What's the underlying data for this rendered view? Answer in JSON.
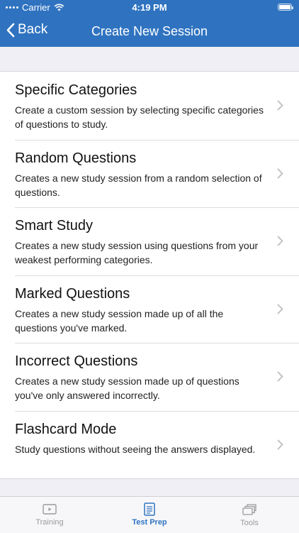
{
  "status_bar": {
    "carrier": "Carrier",
    "time": "4:19 PM"
  },
  "nav": {
    "back_label": "Back",
    "title": "Create New Session"
  },
  "options": [
    {
      "title": "Specific Categories",
      "description": "Create a custom session by selecting specific categories of questions to study."
    },
    {
      "title": "Random Questions",
      "description": "Creates a new study session from a random selection of questions."
    },
    {
      "title": "Smart Study",
      "description": "Creates a new study session using questions from your weakest performing categories."
    },
    {
      "title": "Marked Questions",
      "description": "Creates a new study session made up of all the questions you've marked."
    },
    {
      "title": "Incorrect Questions",
      "description": "Creates a new study session made up of questions you've only answered incorrectly."
    },
    {
      "title": "Flashcard Mode",
      "description": "Study questions without seeing the answers displayed."
    }
  ],
  "tabs": [
    {
      "label": "Training",
      "icon": "video-icon"
    },
    {
      "label": "Test Prep",
      "icon": "document-icon"
    },
    {
      "label": "Tools",
      "icon": "stack-icon"
    }
  ],
  "active_tab": "Test Prep",
  "colors": {
    "accent": "#2f73c0",
    "background": "#f0eff5",
    "inactive_tab": "#9a9a9e"
  }
}
